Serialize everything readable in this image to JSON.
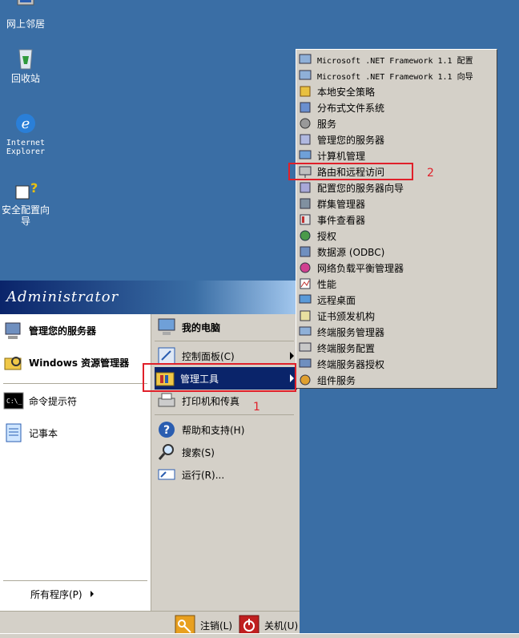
{
  "desktop": {
    "icons": [
      {
        "label": "网上邻居",
        "icon": "network-icon"
      },
      {
        "label": "回收站",
        "icon": "recycle-bin-icon"
      },
      {
        "label": "Internet Explorer",
        "icon": "ie-icon"
      },
      {
        "label": "安全配置向导",
        "icon": "security-wizard-icon"
      }
    ]
  },
  "start_menu": {
    "user": "Administrator",
    "left_items": [
      {
        "label": "管理您的服务器",
        "icon": "server-manager-icon"
      },
      {
        "label": "Windows 资源管理器",
        "icon": "explorer-icon"
      },
      {
        "label": "命令提示符",
        "icon": "cmd-icon"
      },
      {
        "label": "记事本",
        "icon": "notepad-icon"
      }
    ],
    "all_programs": "所有程序(P)",
    "right_items": [
      {
        "label": "我的电脑",
        "icon": "my-computer-icon"
      },
      {
        "label": "控制面板(C)",
        "icon": "control-panel-icon"
      },
      {
        "label": "管理工具",
        "icon": "admin-tools-icon"
      },
      {
        "label": "打印机和传真",
        "icon": "printer-icon"
      },
      {
        "label": "帮助和支持(H)",
        "icon": "help-icon"
      },
      {
        "label": "搜索(S)",
        "icon": "search-icon"
      },
      {
        "label": "运行(R)...",
        "icon": "run-icon"
      }
    ],
    "logoff": "注销(L)",
    "shutdown": "关机(U)"
  },
  "submenu": {
    "items": [
      {
        "label": "Microsoft .NET Framework 1.1 配置",
        "icon": "net-config-icon"
      },
      {
        "label": "Microsoft .NET Framework 1.1 向导",
        "icon": "net-wizard-icon"
      },
      {
        "label": "本地安全策略",
        "icon": "local-security-icon"
      },
      {
        "label": "分布式文件系统",
        "icon": "dfs-icon"
      },
      {
        "label": "服务",
        "icon": "services-icon"
      },
      {
        "label": "管理您的服务器",
        "icon": "manage-server-icon"
      },
      {
        "label": "计算机管理",
        "icon": "computer-management-icon"
      },
      {
        "label": "路由和远程访问",
        "icon": "routing-icon"
      },
      {
        "label": "配置您的服务器向导",
        "icon": "configure-server-icon"
      },
      {
        "label": "群集管理器",
        "icon": "cluster-icon"
      },
      {
        "label": "事件查看器",
        "icon": "event-viewer-icon"
      },
      {
        "label": "授权",
        "icon": "licensing-icon"
      },
      {
        "label": "数据源 (ODBC)",
        "icon": "odbc-icon"
      },
      {
        "label": "网络负载平衡管理器",
        "icon": "nlb-icon"
      },
      {
        "label": "性能",
        "icon": "performance-icon"
      },
      {
        "label": "远程桌面",
        "icon": "remote-desktop-icon"
      },
      {
        "label": "证书颁发机构",
        "icon": "certificate-icon"
      },
      {
        "label": "终端服务管理器",
        "icon": "ts-manager-icon"
      },
      {
        "label": "终端服务配置",
        "icon": "ts-config-icon"
      },
      {
        "label": "终端服务器授权",
        "icon": "ts-licensing-icon"
      },
      {
        "label": "组件服务",
        "icon": "component-services-icon"
      }
    ]
  },
  "annotations": {
    "step1": "1",
    "step2": "2"
  }
}
